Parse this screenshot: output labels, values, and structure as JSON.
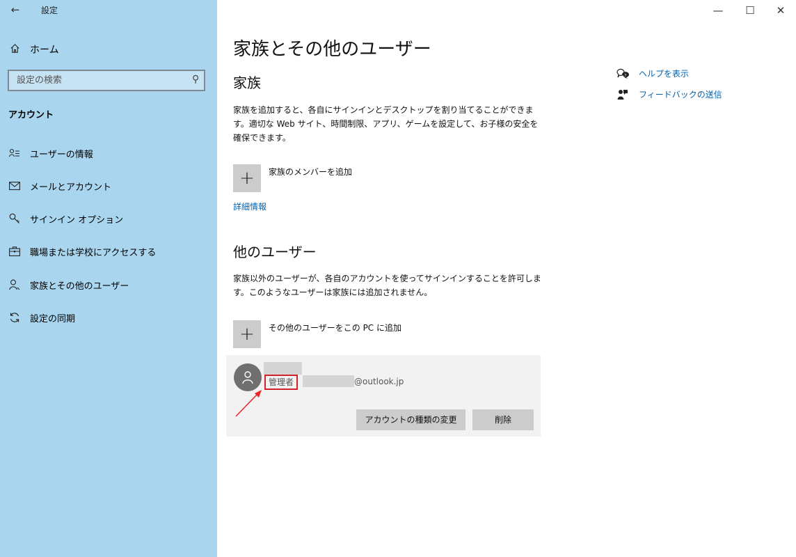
{
  "window": {
    "title": "設定",
    "controls": {
      "minimize": "—",
      "maximize": "☐",
      "close": "✕"
    }
  },
  "sidebar": {
    "back_icon": "←",
    "home": {
      "icon": "home-icon",
      "label": "ホーム"
    },
    "search": {
      "placeholder": "設定の検索"
    },
    "section_title": "アカウント",
    "items": [
      {
        "icon": "user-info-icon",
        "label": "ユーザーの情報"
      },
      {
        "icon": "mail-icon",
        "label": "メールとアカウント"
      },
      {
        "icon": "key-icon",
        "label": "サインイン オプション"
      },
      {
        "icon": "briefcase-icon",
        "label": "職場または学校にアクセスする"
      },
      {
        "icon": "person-add-icon",
        "label": "家族とその他のユーザー"
      },
      {
        "icon": "sync-icon",
        "label": "設定の同期"
      }
    ]
  },
  "main": {
    "title": "家族とその他のユーザー",
    "family": {
      "heading": "家族",
      "description": "家族を追加すると、各自にサインインとデスクトップを割り当てることができます。適切な Web サイト、時間制限、アプリ、ゲームを設定して、お子様の安全を確保できます。",
      "add_label": "家族のメンバーを追加",
      "more_info": "詳細情報"
    },
    "other_users": {
      "heading": "他のユーザー",
      "description": "家族以外のユーザーが、各自のアカウントを使ってサインインすることを許可します。このようなユーザーは家族には追加されません。",
      "add_label": "その他のユーザーをこの PC に追加",
      "user": {
        "role": "管理者",
        "email_domain": "@outlook.jp",
        "change_type_button": "アカウントの種類の変更",
        "remove_button": "削除"
      }
    }
  },
  "right_panel": {
    "help": "ヘルプを表示",
    "feedback": "フィードバックの送信"
  },
  "colors": {
    "sidebar_bg": "#a9d6ee",
    "accent_link": "#0063b1",
    "highlight_red": "#d3202a"
  }
}
